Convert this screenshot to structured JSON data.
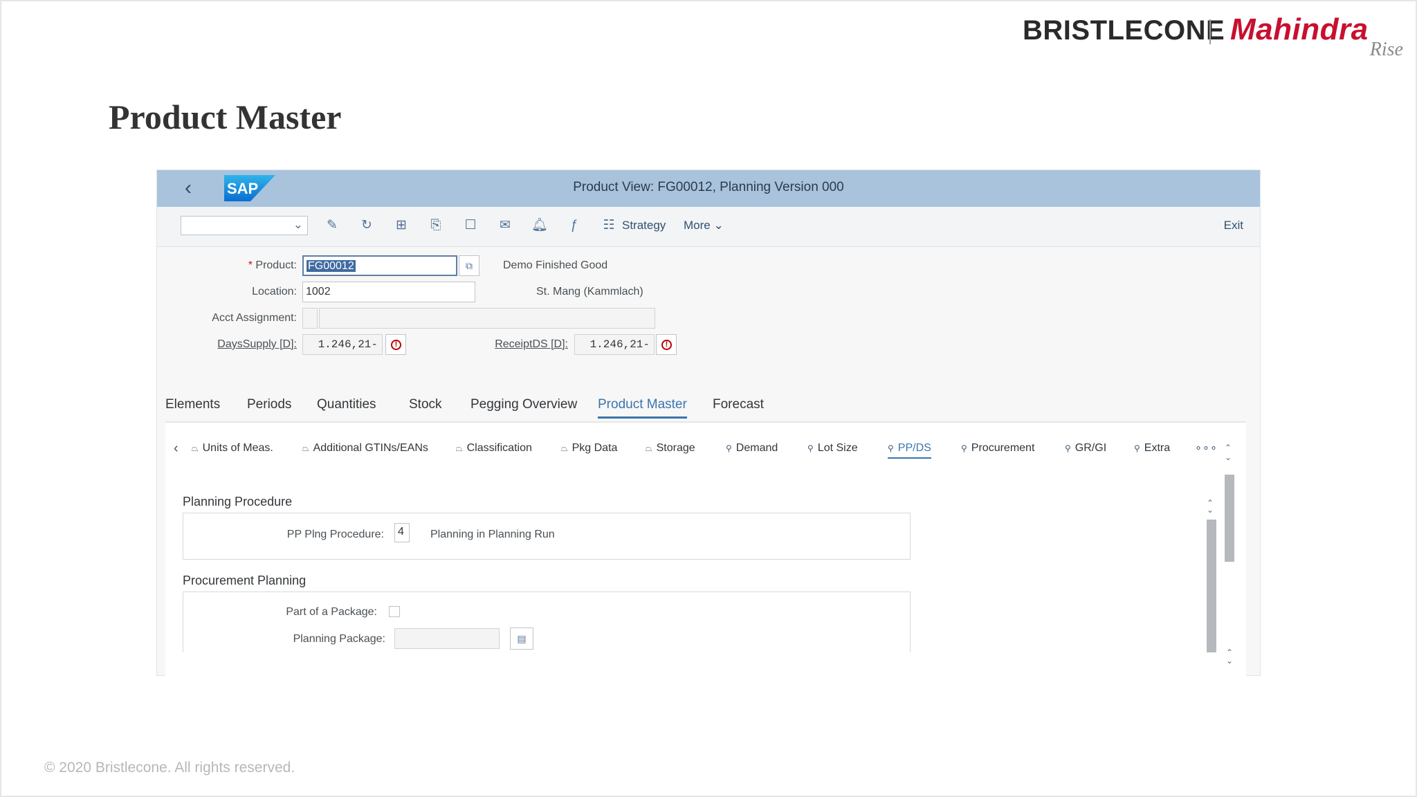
{
  "slide": {
    "brand_left": "BRISTLECONE",
    "brand_right": "Mahindra",
    "brand_right_sub": "Rise",
    "title": "Product Master",
    "footer": "© 2020 Bristlecone. All rights reserved."
  },
  "shell": {
    "logo_text": "SAP",
    "title": "Product View: FG00012, Planning Version 000"
  },
  "toolbar": {
    "select_value": "",
    "icons": [
      "edit-icon",
      "refresh-icon",
      "hierarchy-icon",
      "copy-doc-icon",
      "display-icon",
      "mail-icon",
      "bell-icon",
      "formula-icon"
    ],
    "strategy_label": "Strategy",
    "more_label": "More",
    "exit_label": "Exit"
  },
  "header": {
    "product_label": "Product:",
    "product_value": "FG00012",
    "product_desc": "Demo Finished Good",
    "location_label": "Location:",
    "location_value": "1002",
    "location_desc": "St. Mang (Kammlach)",
    "acct_label": "Acct Assignment:",
    "acct_value": "",
    "dayssupply_label": "DaysSupply [D]:",
    "dayssupply_value": "1.246,21-",
    "receiptds_label": "ReceiptDS [D]:",
    "receiptds_value": "1.246,21-"
  },
  "tabs": [
    "Elements",
    "Periods",
    "Quantities",
    "Stock",
    "Pegging Overview",
    "Product Master",
    "Forecast"
  ],
  "active_tab": "Product Master",
  "subtabs": [
    {
      "label": "Units of Meas.",
      "icon": "hat-icon"
    },
    {
      "label": "Additional GTINs/EANs",
      "icon": "hat-icon"
    },
    {
      "label": "Classification",
      "icon": "hat-icon"
    },
    {
      "label": "Pkg Data",
      "icon": "hat-icon"
    },
    {
      "label": "Storage",
      "icon": "hat-icon"
    },
    {
      "label": "Demand",
      "icon": "pin-icon"
    },
    {
      "label": "Lot Size",
      "icon": "pin-icon"
    },
    {
      "label": "PP/DS",
      "icon": "pin-icon"
    },
    {
      "label": "Procurement",
      "icon": "pin-icon"
    },
    {
      "label": "GR/GI",
      "icon": "pin-icon"
    },
    {
      "label": "Extra",
      "icon": "pin-icon"
    }
  ],
  "active_subtab": "PP/DS",
  "planning_procedure": {
    "title": "Planning Procedure",
    "label": "PP Plng Procedure:",
    "value": "4",
    "desc": "Planning in Planning Run"
  },
  "procurement_planning": {
    "title": "Procurement Planning",
    "package_label": "Part of a Package:",
    "package_checked": false,
    "planning_package_label": "Planning Package:",
    "planning_package_value": ""
  }
}
